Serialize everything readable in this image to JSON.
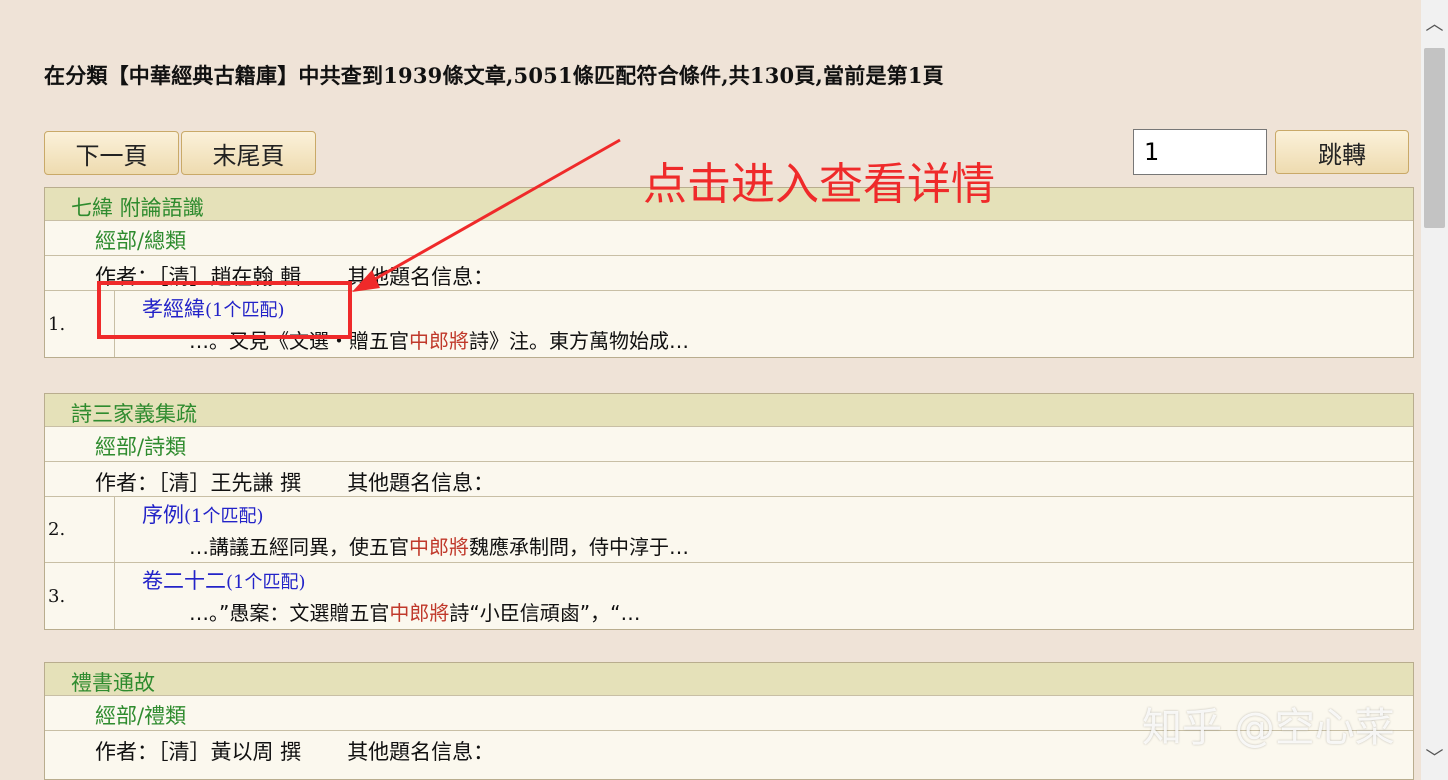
{
  "summary": "在分類【中華經典古籍庫】中共查到1939條文章,5051條匹配符合條件,共130頁,當前是第1頁",
  "nav": {
    "next_label": "下一頁",
    "last_label": "末尾頁",
    "page_value": "1",
    "jump_label": "跳轉"
  },
  "results": [
    {
      "title": "七緯 附論語讖",
      "category": "經部/總類",
      "author_label": "作者：",
      "author": "［清］趙在翰 輯",
      "other_label": "其他題名信息：",
      "matches": [
        {
          "num": "1.",
          "name": "孝經緯",
          "count": "(1个匹配)",
          "pre": "…。又見《文選・贈五官",
          "hit": "中郎將",
          "post": "詩》注。東方萬物始成…"
        }
      ]
    },
    {
      "title": "詩三家義集疏",
      "category": "經部/詩類",
      "author_label": "作者：",
      "author": "［清］王先謙 撰",
      "other_label": "其他題名信息：",
      "matches": [
        {
          "num": "2.",
          "name": "序例",
          "count": "(1个匹配)",
          "pre": "…講議五經同異，使五官",
          "hit": "中郎將",
          "post": "魏應承制問，侍中淳于…"
        },
        {
          "num": "3.",
          "name": "卷二十二",
          "count": "(1个匹配)",
          "pre": "…。”愚案：文選贈五官",
          "hit": "中郎將",
          "post": "詩“小臣信頑鹵”，“…"
        }
      ]
    },
    {
      "title": "禮書通故",
      "category": "經部/禮類",
      "author_label": "作者：",
      "author": "［清］黃以周 撰",
      "other_label": "其他題名信息：",
      "matches": []
    }
  ],
  "annotation": {
    "text": "点击进入查看详情",
    "color": "#ef2a2a"
  },
  "watermark": "知乎 @空心菜",
  "colors": {
    "background": "#efe3d7",
    "title_green": "#2e8b2e",
    "link_blue": "#2323c8",
    "highlight_red": "#c0392b"
  }
}
